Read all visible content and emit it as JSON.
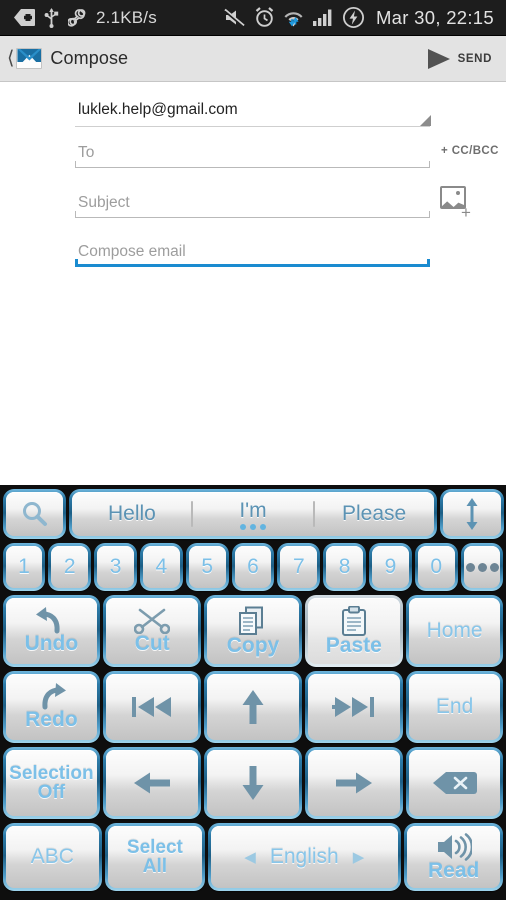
{
  "status_bar": {
    "icons_left": [
      "usb-debug-icon",
      "usb-icon",
      "link-icon"
    ],
    "data_rate": "2.1KB/s",
    "icons_right": [
      "mute-icon",
      "alarm-icon",
      "wifi-icon",
      "signal-icon",
      "charging-icon"
    ],
    "clock": "Mar 30, 22:15",
    "background": "#1d1d1d",
    "text_color": "#d8d8d8"
  },
  "action_bar": {
    "back_icon": "back-chevron-icon",
    "app_icon": "gmail-envelope-icon",
    "title": "Compose",
    "send_icon": "send-arrow-icon",
    "send_label": "SEND",
    "background": "#e3e3e3"
  },
  "compose": {
    "account": {
      "value": "luklek.help@gmail.com",
      "dropdown_icon": "dropdown-caret-icon"
    },
    "to": {
      "placeholder": "To",
      "value": ""
    },
    "cc_bcc_label": "+ CC/BCC",
    "subject": {
      "placeholder": "Subject",
      "value": ""
    },
    "attach_icon": "insert-image-icon",
    "body": {
      "placeholder": "Compose email",
      "value": "",
      "focused": true,
      "focus_color": "#1a8bd0"
    }
  },
  "keyboard": {
    "background": "#0e0e0e",
    "key_text_color": "#7cc0e8",
    "suggestion_row": {
      "search_key": {
        "label": "",
        "icon": "search-icon"
      },
      "suggestions": [
        {
          "text": "Hello",
          "active": false
        },
        {
          "text": "I'm",
          "active": true
        },
        {
          "text": "Please",
          "active": false
        }
      ],
      "resize_key": {
        "label": "",
        "icon": "resize-vertical-icon"
      }
    },
    "number_row": {
      "keys": [
        "1",
        "2",
        "3",
        "4",
        "5",
        "6",
        "7",
        "8",
        "9",
        "0"
      ],
      "more_key": {
        "label": "",
        "icon": "more-dots-icon"
      }
    },
    "rows": [
      [
        {
          "label": "Undo",
          "icon": "undo-icon",
          "state": "normal"
        },
        {
          "label": "Cut",
          "icon": "scissors-icon",
          "state": "normal"
        },
        {
          "label": "Copy",
          "icon": "copy-icon",
          "state": "normal"
        },
        {
          "label": "Paste",
          "icon": "clipboard-icon",
          "state": "disabled"
        },
        {
          "label": "Home",
          "icon": "",
          "state": "normal"
        }
      ],
      [
        {
          "label": "Redo",
          "icon": "redo-icon",
          "state": "normal"
        },
        {
          "label": "",
          "icon": "skip-backward-icon",
          "state": "normal"
        },
        {
          "label": "",
          "icon": "arrow-up-icon",
          "state": "normal"
        },
        {
          "label": "",
          "icon": "skip-forward-icon",
          "state": "normal"
        },
        {
          "label": "End",
          "icon": "",
          "state": "normal"
        }
      ],
      [
        {
          "label": "Selection\nOff",
          "label_line1": "Selection",
          "label_line2": "Off",
          "icon": "",
          "state": "normal"
        },
        {
          "label": "",
          "icon": "arrow-left-icon",
          "state": "normal"
        },
        {
          "label": "",
          "icon": "arrow-down-icon",
          "state": "normal"
        },
        {
          "label": "",
          "icon": "arrow-right-icon",
          "state": "normal"
        },
        {
          "label": "",
          "icon": "backspace-icon",
          "state": "normal"
        }
      ]
    ],
    "bottom_row": {
      "abc_key": "ABC",
      "select_all_line1": "Select",
      "select_all_line2": "All",
      "space_key": {
        "label": "English",
        "left_arrow": "◄",
        "right_arrow": "►"
      },
      "read_key": {
        "label": "Read",
        "icon": "speaker-icon"
      }
    }
  }
}
